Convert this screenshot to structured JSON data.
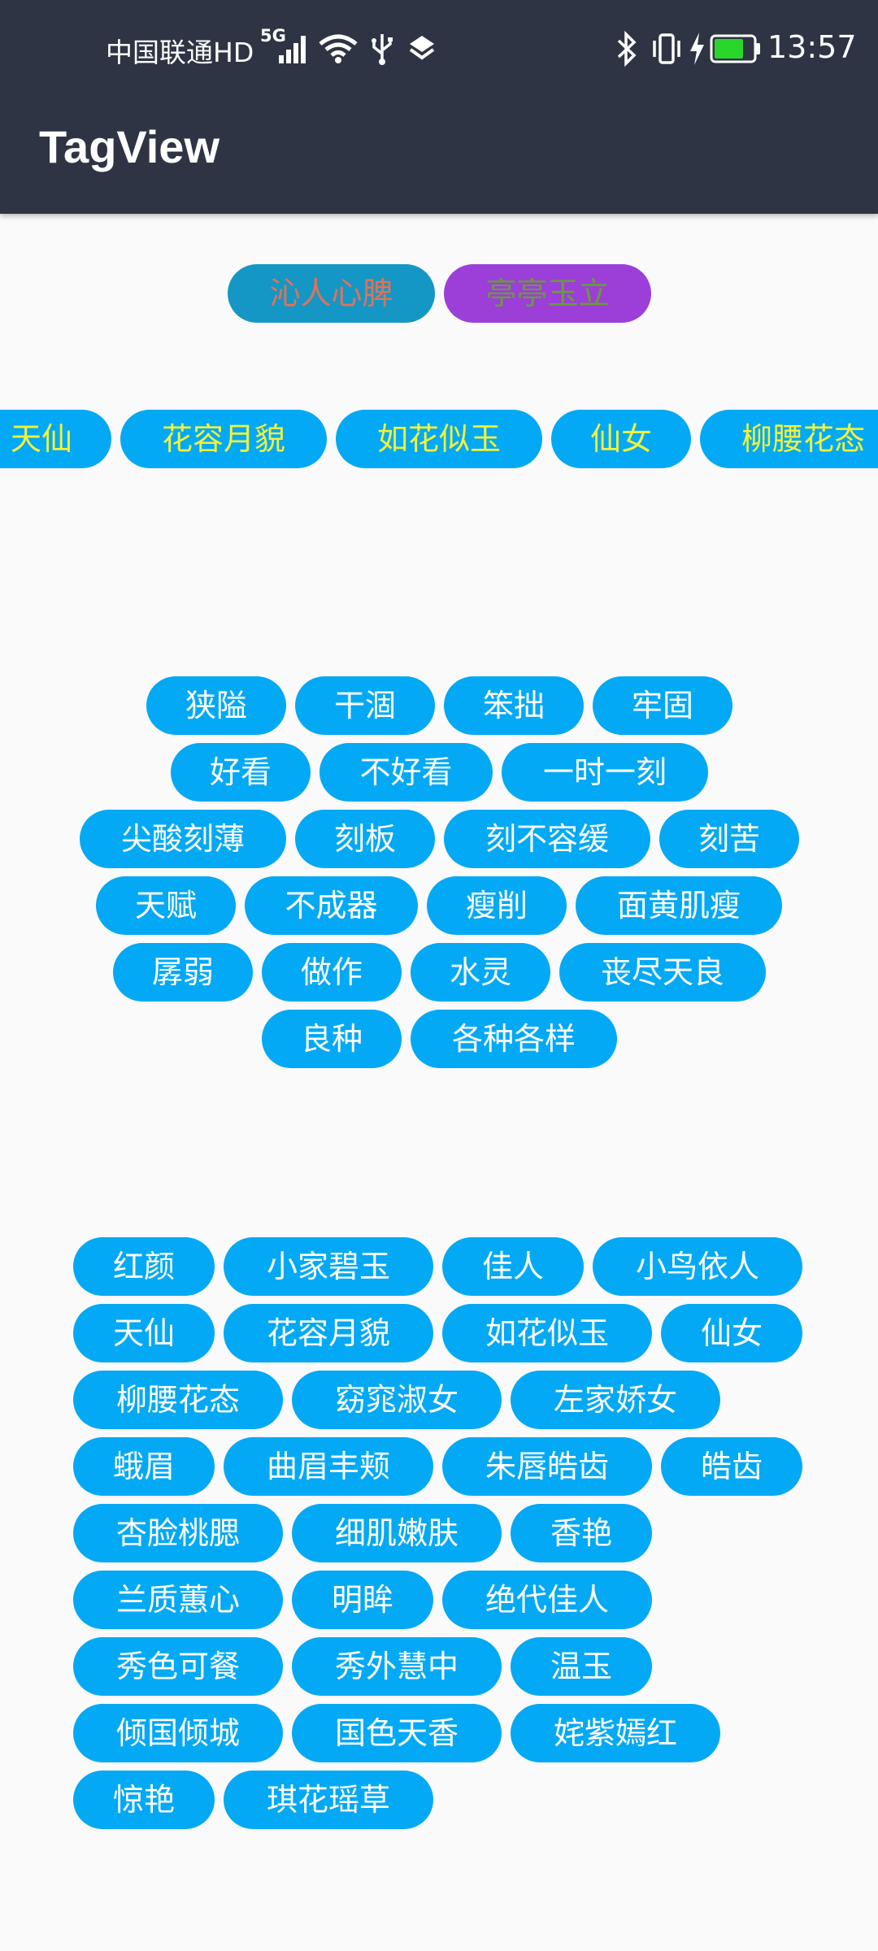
{
  "status_bar": {
    "carrier": "中国联通HD",
    "network": "5G",
    "time": "13:57",
    "icons": [
      "signal-icon",
      "wifi-icon",
      "usb-icon",
      "layers-icon",
      "bluetooth-icon",
      "vibrate-icon",
      "charging-icon",
      "battery-icon"
    ],
    "battery_level": 0.75
  },
  "app_bar": {
    "title": "TagView"
  },
  "colors": {
    "tag_background": "#03a9f4",
    "tag_text": "#ffffff",
    "appbar_background": "#2e3444",
    "page_background": "#fafafa"
  },
  "group1": {
    "tags": [
      {
        "text": "沁人心脾",
        "bg": "#1497c4",
        "color": "#e0725a"
      },
      {
        "text": "亭亭玉立",
        "bg": "#9b3fd8",
        "color": "#6a9a3a"
      }
    ]
  },
  "group2": {
    "tags": [
      {
        "text": "天仙",
        "color": "#f2f23a"
      },
      {
        "text": "花容月貌",
        "color": "#f2f23a"
      },
      {
        "text": "如花似玉",
        "color": "#f2f23a"
      },
      {
        "text": "仙女",
        "color": "#f2f23a"
      },
      {
        "text": "柳腰花态",
        "color": "#f2f23a"
      }
    ]
  },
  "group3": {
    "rows": [
      [
        "狭隘",
        "干涸",
        "笨拙",
        "牢固"
      ],
      [
        "好看",
        "不好看",
        "一时一刻"
      ],
      [
        "尖酸刻薄",
        "刻板",
        "刻不容缓",
        "刻苦"
      ],
      [
        "天赋",
        "不成器",
        "瘦削",
        "面黄肌瘦"
      ],
      [
        "孱弱",
        "做作",
        "水灵",
        "丧尽天良"
      ],
      [
        "良种",
        "各种各样"
      ]
    ]
  },
  "group4": {
    "rows": [
      [
        "红颜",
        "小家碧玉",
        "佳人",
        "小鸟依人"
      ],
      [
        "天仙",
        "花容月貌",
        "如花似玉",
        "仙女"
      ],
      [
        "柳腰花态",
        "窈窕淑女",
        "左家娇女"
      ],
      [
        "蛾眉",
        "曲眉丰颊",
        "朱唇皓齿",
        "皓齿"
      ],
      [
        "杏脸桃腮",
        "细肌嫩肤",
        "香艳"
      ],
      [
        "兰质蕙心",
        "明眸",
        "绝代佳人"
      ],
      [
        "秀色可餐",
        "秀外慧中",
        "温玉"
      ],
      [
        "倾国倾城",
        "国色天香",
        "姹紫嫣红"
      ],
      [
        "惊艳",
        "琪花瑶草"
      ]
    ]
  }
}
